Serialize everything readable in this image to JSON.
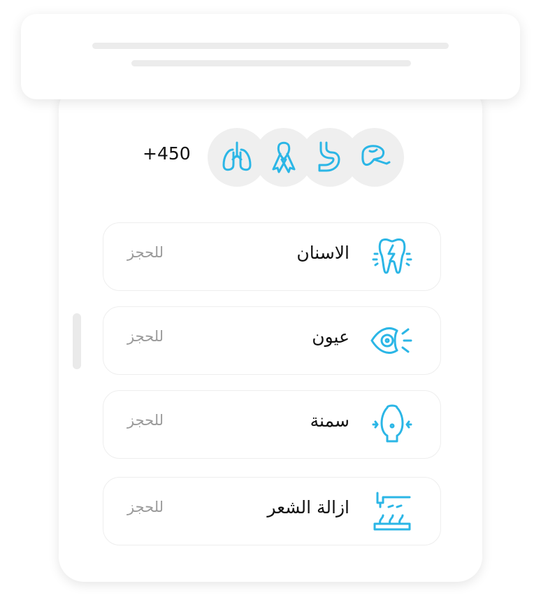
{
  "stats": {
    "count": "+450"
  },
  "specialties": [
    {
      "label": "الاسنان",
      "action": "للحجز",
      "icon": "tooth-icon"
    },
    {
      "label": "عيون",
      "action": "للحجز",
      "icon": "eye-icon"
    },
    {
      "label": "سمنة",
      "action": "للحجز",
      "icon": "obesity-icon"
    },
    {
      "label": "ازالة الشعر",
      "action": "للحجز",
      "icon": "hair-removal-icon"
    }
  ],
  "category_icons": [
    "lungs-icon",
    "ribbon-icon",
    "stomach-icon",
    "liver-icon"
  ],
  "colors": {
    "accent": "#2bb6e6",
    "muted": "#9a9a9a",
    "text": "#111111"
  }
}
